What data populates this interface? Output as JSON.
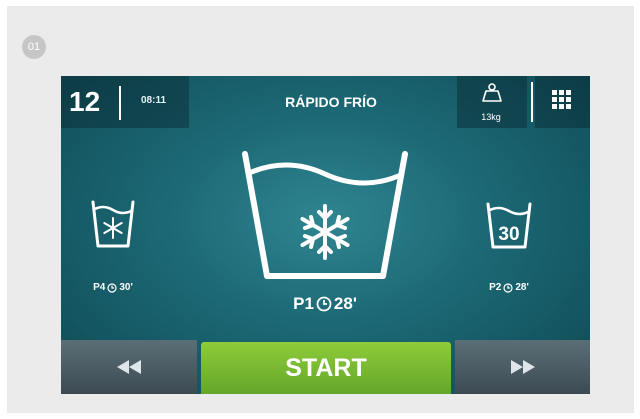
{
  "step_badge": "01",
  "header": {
    "program_number": "12",
    "time": "08:11",
    "program_name": "RÁPIDO FRÍO",
    "load": "13kg"
  },
  "programs": {
    "left": {
      "code": "P4",
      "duration": "30'",
      "symbol": "snowflake-icon"
    },
    "center": {
      "code": "P1",
      "duration": "28'",
      "symbol": "snowflake-icon"
    },
    "right": {
      "code": "P2",
      "duration": "28'",
      "temperature": "30"
    }
  },
  "controls": {
    "start_label": "START",
    "previous_icon": "rewind-icon",
    "next_icon": "fast-forward-icon"
  },
  "colors": {
    "screen_bg": "#1b6773",
    "start_green": "#7dbd33",
    "nav_gray": "#4b5b62"
  }
}
